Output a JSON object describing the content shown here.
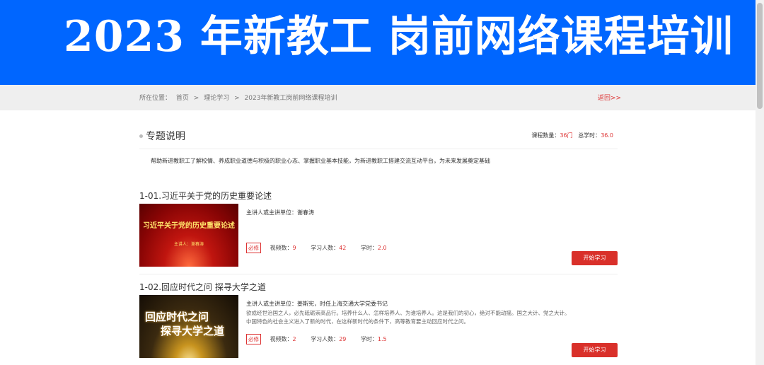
{
  "banner": {
    "title": "2023 年新教工  岗前网络课程培训",
    "bg": "#0066ff"
  },
  "breadcrumb": {
    "prefix": "所在位置：",
    "home": "首页",
    "sep": ">",
    "level2": "理论学习",
    "current": "2023年新教工岗前网络课程培训",
    "back": "返回>>"
  },
  "topic": {
    "title": "专题说明",
    "count_label": "课程数量：",
    "count_value": "36门",
    "hours_label": "总学时：",
    "hours_value": "36.0",
    "description": "帮助新进教职工了解校情、养成职业道德与积极的职业心态、掌握职业基本技能，为新进教职工搭建交流互动平台，为未来发展奠定基础"
  },
  "courses": [
    {
      "title": "1-01.习近平关于党的历史重要论述",
      "lecturer": "主讲人或主讲单位：谢春涛",
      "intro": [],
      "tag": "必修",
      "videos_label": "视频数：",
      "videos": "9",
      "learners_label": "学习人数：",
      "learners": "42",
      "hours_label": "学时：",
      "hours": "2.0",
      "button": "开始学习",
      "thumb_text": "习近平关于党的历史重要论述",
      "thumb_sub": "主讲人：谢春涛"
    },
    {
      "title": "1-02.回应时代之问 探寻大学之道",
      "lecturer": "主讲人或主讲单位：姜斯宪，时任上海交通大学党委书记",
      "intro": [
        "欲成经世治国之人，必先砥砺崇高品行。培养什么人、怎样培养人、为谁培养人。这是我们的初心，绝对不能动摇。国之大计、党之大计。",
        "中国特色的社会主义进入了新的时代，在这样新时代的条件下，高等教育要主动回应时代之问。"
      ],
      "tag": "必修",
      "videos_label": "视频数：",
      "videos": "2",
      "learners_label": "学习人数：",
      "learners": "29",
      "hours_label": "学时：",
      "hours": "1.5",
      "button": "开始学习",
      "thumb_text_1": "回应时代之问",
      "thumb_text_2": "探寻大学之道"
    }
  ],
  "colors": {
    "accent": "#d9302a",
    "banner": "#0066ff"
  }
}
